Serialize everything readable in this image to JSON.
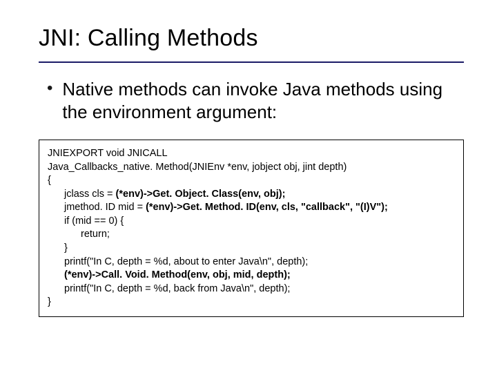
{
  "title": "JNI: Calling Methods",
  "bullet": "Native methods can invoke Java methods using the environment argument:",
  "code": {
    "l1": "JNIEXPORT void JNICALL",
    "l2": "Java_Callbacks_native. Method(JNIEnv *env, jobject obj, jint depth)",
    "l3": "{",
    "l4a": "jclass cls = ",
    "l4b": "(*env)->Get. Object. Class(env, obj);",
    "l5a": "jmethod. ID mid = ",
    "l5b": "(*env)->Get. Method. ID(env, cls, \"callback\", \"(I)V\");",
    "l6": "if (mid == 0) {",
    "l7": "return;",
    "l8": "}",
    "l9": "printf(\"In C, depth = %d, about to enter Java\\n\", depth);",
    "l10": "(*env)->Call. Void. Method(env, obj, mid, depth);",
    "l11": "printf(\"In C, depth = %d, back from Java\\n\", depth);",
    "l12": "}"
  }
}
